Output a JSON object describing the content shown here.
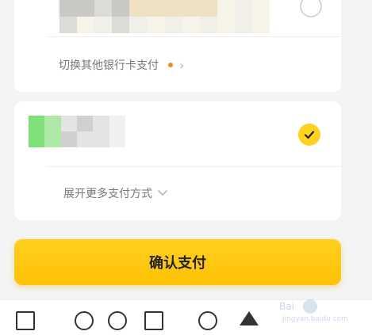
{
  "bank_card": {
    "switch_label": "切换其他银行卡支付",
    "chevron": ">"
  },
  "selected_method": {
    "expand_label": "展开更多支付方式"
  },
  "confirm": {
    "label": "确认支付"
  },
  "colors": {
    "accent": "#ffc107",
    "dot": "#f08a22"
  },
  "watermark": {
    "brand": "Bai",
    "sub": "jingyan.baidu.com"
  }
}
